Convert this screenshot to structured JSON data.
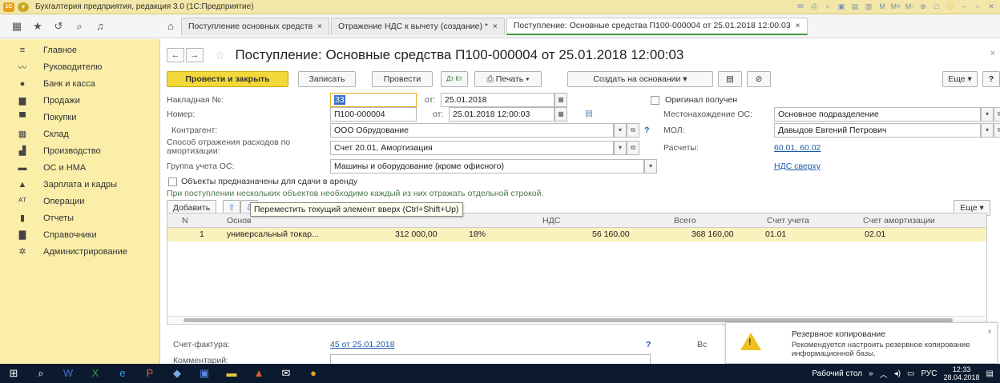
{
  "titlebar": {
    "logo": "1С",
    "title": "Бухгалтерия предприятия, редакция 3.0 (1С:Предприятие)",
    "right_icons": [
      "M",
      "M+",
      "M-"
    ]
  },
  "tabs": [
    {
      "label": "Поступление основных средств",
      "close": "×"
    },
    {
      "label": "Отражение НДС к вычету (создание) *",
      "close": "×"
    },
    {
      "label": "Поступление: Основные средства П100-000004 от 25.01.2018 12:00:03",
      "close": "×"
    }
  ],
  "sidebar": {
    "items": [
      {
        "icon": "≡",
        "label": "Главное"
      },
      {
        "icon": "〰",
        "label": "Руководителю"
      },
      {
        "icon": "●",
        "label": "Банк и касса"
      },
      {
        "icon": "▆",
        "label": "Продажи"
      },
      {
        "icon": "▀",
        "label": "Покупки"
      },
      {
        "icon": "▦",
        "label": "Склад"
      },
      {
        "icon": "▟",
        "label": "Производство"
      },
      {
        "icon": "▬",
        "label": "ОС и НМА"
      },
      {
        "icon": "▲",
        "label": "Зарплата и кадры"
      },
      {
        "icon": "ᴬᵀ",
        "label": "Операции"
      },
      {
        "icon": "▮",
        "label": "Отчеты"
      },
      {
        "icon": "▇",
        "label": "Справочники"
      },
      {
        "icon": "✲",
        "label": "Администрирование"
      }
    ]
  },
  "document": {
    "title": "Поступление: Основные средства П100-000004 от 25.01.2018 12:00:03",
    "close": "×"
  },
  "buttons": {
    "post_close": "Провести и закрыть",
    "write": "Записать",
    "post": "Провести",
    "dt_kt": "Дт Кт",
    "print": "Печать",
    "create_based": "Создать на основании",
    "more": "Еще",
    "help": "?"
  },
  "form": {
    "invoice_no_label": "Накладная №:",
    "invoice_no_value": "33",
    "from_label": "от:",
    "invoice_date": "25.01.2018",
    "number_label": "Номер:",
    "number_value": "П100-000004",
    "number_date": "25.01.2018 12:00:03",
    "original_received": "Оригинал получен",
    "location_label": "Местонахождение ОС:",
    "location_value": "Основное подразделение",
    "counterparty_label": "Контрагент:",
    "counterparty_value": "ООО Обрудование",
    "mol_label": "МОЛ:",
    "mol_value": "Давыдов Евгений Петрович",
    "expense_label_1": "Способ отражения расходов по",
    "expense_label_2": "амортизации:",
    "expense_value": "Счет 20.01, Амортизация",
    "settlements_label": "Расчеты:",
    "settlements_value": "60.01, 60.02",
    "group_label": "Группа учета ОС:",
    "group_value": "Машины и оборудование (кроме офисного)",
    "vat_link": "НДС сверху",
    "rent_checkbox": "Объекты предназначены для сдачи в аренду",
    "hint": "При поступлении нескольких объектов необходимо каждый из них отражать отдельной строкой.",
    "question": "?"
  },
  "table": {
    "add_button": "Добавить",
    "more": "Еще",
    "tooltip": "Переместить текущий элемент вверх (Ctrl+Shift+Up)",
    "headers": [
      "N",
      "Основ",
      "НДС",
      "Всего",
      "Счет учета",
      "Счет амортизации"
    ],
    "rows": [
      {
        "n": "1",
        "name": "универсальный токар...",
        "sum": "312 000,00",
        "rate": "18%",
        "vat": "56 160,00",
        "total": "368 160,00",
        "account": "01.01",
        "amort_account": "02.01"
      }
    ]
  },
  "footer": {
    "invoice_label": "Счет-фактура:",
    "invoice_link": "45 от 25.01.2018",
    "comment_label": "Комментарий:",
    "question": "?",
    "cut_text": "Вс"
  },
  "notification": {
    "title": "Резервное копирование",
    "text": "Рекомендуется настроить резервное копирование информационной базы.",
    "warn_mark": "!",
    "close": "×"
  },
  "taskbar": {
    "desktop_label": "Рабочий стол",
    "lang": "РУС",
    "time": "12:33",
    "date": "28.04.2018",
    "arrows": "»"
  },
  "colors": {
    "sidebar_bg": "#fbeea9",
    "primary_button": "#f3d83a",
    "selected_row": "#faf1bc",
    "link": "#1a5aa8",
    "taskbar": "#0b1a2e"
  }
}
